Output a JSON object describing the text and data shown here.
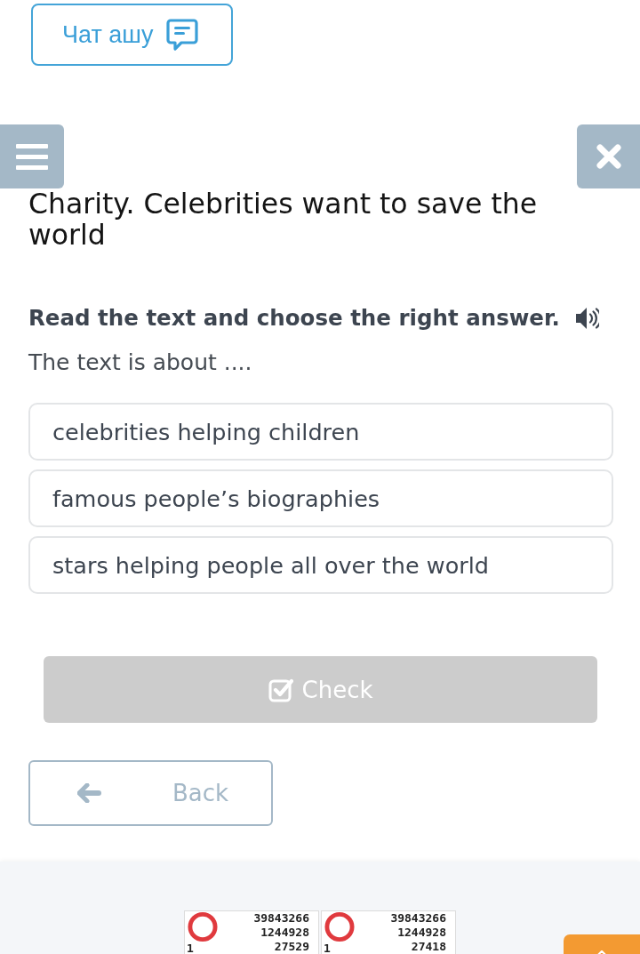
{
  "chat_button": {
    "label": "Чат ашу"
  },
  "lesson": {
    "title": "Charity. Celebrities want to save the world"
  },
  "task": {
    "instruction": "Read the text and choose the right answer.",
    "question": "The text is about ....",
    "options": [
      {
        "label": "celebrities helping children",
        "selected": false
      },
      {
        "label": "famous people’s biographies",
        "selected": false
      },
      {
        "label": "stars helping people all over the world",
        "selected": false
      }
    ]
  },
  "check_button": {
    "label": "Check",
    "disabled": true
  },
  "back_button": {
    "label": "Back"
  },
  "footer": {
    "counters": [
      {
        "lines": [
          "39843266",
          "1244928",
          "27529"
        ],
        "corner": "1"
      },
      {
        "lines": [
          "39843266",
          "1244928",
          "27418"
        ],
        "corner": "1"
      }
    ]
  }
}
